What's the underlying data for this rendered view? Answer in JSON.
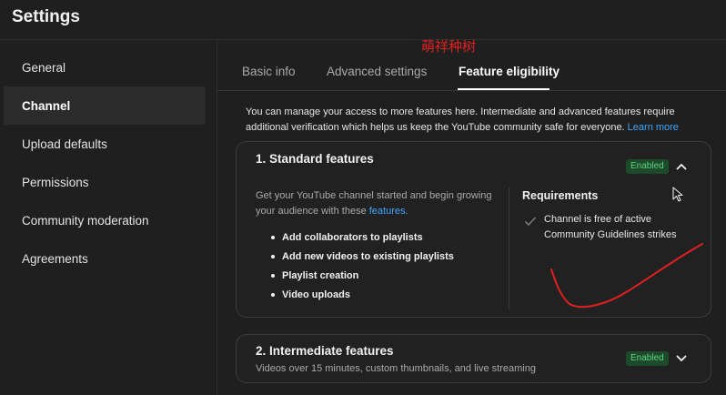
{
  "header": {
    "title": "Settings"
  },
  "watermark": "萌祥种树",
  "sidebar": {
    "items": [
      {
        "label": "General"
      },
      {
        "label": "Channel"
      },
      {
        "label": "Upload defaults"
      },
      {
        "label": "Permissions"
      },
      {
        "label": "Community moderation"
      },
      {
        "label": "Agreements"
      }
    ],
    "active": "Channel"
  },
  "tabs": [
    {
      "label": "Basic info"
    },
    {
      "label": "Advanced settings"
    },
    {
      "label": "Feature eligibility"
    }
  ],
  "active_tab": "Feature eligibility",
  "intro": {
    "text": "You can manage your access to more features here. Intermediate and advanced features require additional verification which helps us keep the YouTube community safe for everyone. ",
    "link": "Learn more"
  },
  "standard": {
    "title": "1. Standard features",
    "badge": "Enabled",
    "desc": "Get your YouTube channel started and begin growing your audience with these ",
    "desc_link": "features.",
    "features": [
      "Add collaborators to playlists",
      "Add new videos to existing playlists",
      "Playlist creation",
      "Video uploads"
    ],
    "requirements_title": "Requirements",
    "requirement": "Channel is free of active Community Guidelines strikes"
  },
  "intermediate": {
    "title": "2. Intermediate features",
    "badge": "Enabled",
    "desc": "Videos over 15 minutes, custom thumbnails, and live streaming"
  },
  "colors": {
    "background": "#1f1f1f",
    "card": "#212121",
    "link": "#3ea6ff",
    "badge_bg": "#1d4a2a",
    "badge_text": "#5ed37f",
    "annotation": "#e02020"
  },
  "icons": [
    "chevron-up-icon",
    "chevron-down-icon",
    "check-icon",
    "cursor-icon"
  ]
}
